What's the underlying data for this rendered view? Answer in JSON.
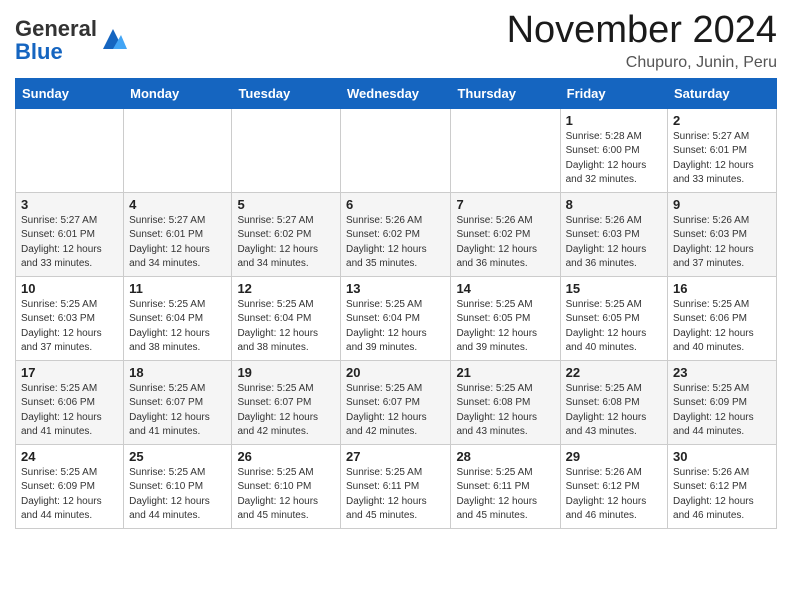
{
  "header": {
    "logo": {
      "general": "General",
      "blue": "Blue"
    },
    "month": "November 2024",
    "location": "Chupuro, Junin, Peru"
  },
  "weekdays": [
    "Sunday",
    "Monday",
    "Tuesday",
    "Wednesday",
    "Thursday",
    "Friday",
    "Saturday"
  ],
  "weeks": [
    [
      {
        "day": "",
        "sunrise": "",
        "sunset": "",
        "daylight": ""
      },
      {
        "day": "",
        "sunrise": "",
        "sunset": "",
        "daylight": ""
      },
      {
        "day": "",
        "sunrise": "",
        "sunset": "",
        "daylight": ""
      },
      {
        "day": "",
        "sunrise": "",
        "sunset": "",
        "daylight": ""
      },
      {
        "day": "",
        "sunrise": "",
        "sunset": "",
        "daylight": ""
      },
      {
        "day": "1",
        "sunrise": "Sunrise: 5:28 AM",
        "sunset": "Sunset: 6:00 PM",
        "daylight": "Daylight: 12 hours and 32 minutes."
      },
      {
        "day": "2",
        "sunrise": "Sunrise: 5:27 AM",
        "sunset": "Sunset: 6:01 PM",
        "daylight": "Daylight: 12 hours and 33 minutes."
      }
    ],
    [
      {
        "day": "3",
        "sunrise": "Sunrise: 5:27 AM",
        "sunset": "Sunset: 6:01 PM",
        "daylight": "Daylight: 12 hours and 33 minutes."
      },
      {
        "day": "4",
        "sunrise": "Sunrise: 5:27 AM",
        "sunset": "Sunset: 6:01 PM",
        "daylight": "Daylight: 12 hours and 34 minutes."
      },
      {
        "day": "5",
        "sunrise": "Sunrise: 5:27 AM",
        "sunset": "Sunset: 6:02 PM",
        "daylight": "Daylight: 12 hours and 34 minutes."
      },
      {
        "day": "6",
        "sunrise": "Sunrise: 5:26 AM",
        "sunset": "Sunset: 6:02 PM",
        "daylight": "Daylight: 12 hours and 35 minutes."
      },
      {
        "day": "7",
        "sunrise": "Sunrise: 5:26 AM",
        "sunset": "Sunset: 6:02 PM",
        "daylight": "Daylight: 12 hours and 36 minutes."
      },
      {
        "day": "8",
        "sunrise": "Sunrise: 5:26 AM",
        "sunset": "Sunset: 6:03 PM",
        "daylight": "Daylight: 12 hours and 36 minutes."
      },
      {
        "day": "9",
        "sunrise": "Sunrise: 5:26 AM",
        "sunset": "Sunset: 6:03 PM",
        "daylight": "Daylight: 12 hours and 37 minutes."
      }
    ],
    [
      {
        "day": "10",
        "sunrise": "Sunrise: 5:25 AM",
        "sunset": "Sunset: 6:03 PM",
        "daylight": "Daylight: 12 hours and 37 minutes."
      },
      {
        "day": "11",
        "sunrise": "Sunrise: 5:25 AM",
        "sunset": "Sunset: 6:04 PM",
        "daylight": "Daylight: 12 hours and 38 minutes."
      },
      {
        "day": "12",
        "sunrise": "Sunrise: 5:25 AM",
        "sunset": "Sunset: 6:04 PM",
        "daylight": "Daylight: 12 hours and 38 minutes."
      },
      {
        "day": "13",
        "sunrise": "Sunrise: 5:25 AM",
        "sunset": "Sunset: 6:04 PM",
        "daylight": "Daylight: 12 hours and 39 minutes."
      },
      {
        "day": "14",
        "sunrise": "Sunrise: 5:25 AM",
        "sunset": "Sunset: 6:05 PM",
        "daylight": "Daylight: 12 hours and 39 minutes."
      },
      {
        "day": "15",
        "sunrise": "Sunrise: 5:25 AM",
        "sunset": "Sunset: 6:05 PM",
        "daylight": "Daylight: 12 hours and 40 minutes."
      },
      {
        "day": "16",
        "sunrise": "Sunrise: 5:25 AM",
        "sunset": "Sunset: 6:06 PM",
        "daylight": "Daylight: 12 hours and 40 minutes."
      }
    ],
    [
      {
        "day": "17",
        "sunrise": "Sunrise: 5:25 AM",
        "sunset": "Sunset: 6:06 PM",
        "daylight": "Daylight: 12 hours and 41 minutes."
      },
      {
        "day": "18",
        "sunrise": "Sunrise: 5:25 AM",
        "sunset": "Sunset: 6:07 PM",
        "daylight": "Daylight: 12 hours and 41 minutes."
      },
      {
        "day": "19",
        "sunrise": "Sunrise: 5:25 AM",
        "sunset": "Sunset: 6:07 PM",
        "daylight": "Daylight: 12 hours and 42 minutes."
      },
      {
        "day": "20",
        "sunrise": "Sunrise: 5:25 AM",
        "sunset": "Sunset: 6:07 PM",
        "daylight": "Daylight: 12 hours and 42 minutes."
      },
      {
        "day": "21",
        "sunrise": "Sunrise: 5:25 AM",
        "sunset": "Sunset: 6:08 PM",
        "daylight": "Daylight: 12 hours and 43 minutes."
      },
      {
        "day": "22",
        "sunrise": "Sunrise: 5:25 AM",
        "sunset": "Sunset: 6:08 PM",
        "daylight": "Daylight: 12 hours and 43 minutes."
      },
      {
        "day": "23",
        "sunrise": "Sunrise: 5:25 AM",
        "sunset": "Sunset: 6:09 PM",
        "daylight": "Daylight: 12 hours and 44 minutes."
      }
    ],
    [
      {
        "day": "24",
        "sunrise": "Sunrise: 5:25 AM",
        "sunset": "Sunset: 6:09 PM",
        "daylight": "Daylight: 12 hours and 44 minutes."
      },
      {
        "day": "25",
        "sunrise": "Sunrise: 5:25 AM",
        "sunset": "Sunset: 6:10 PM",
        "daylight": "Daylight: 12 hours and 44 minutes."
      },
      {
        "day": "26",
        "sunrise": "Sunrise: 5:25 AM",
        "sunset": "Sunset: 6:10 PM",
        "daylight": "Daylight: 12 hours and 45 minutes."
      },
      {
        "day": "27",
        "sunrise": "Sunrise: 5:25 AM",
        "sunset": "Sunset: 6:11 PM",
        "daylight": "Daylight: 12 hours and 45 minutes."
      },
      {
        "day": "28",
        "sunrise": "Sunrise: 5:25 AM",
        "sunset": "Sunset: 6:11 PM",
        "daylight": "Daylight: 12 hours and 45 minutes."
      },
      {
        "day": "29",
        "sunrise": "Sunrise: 5:26 AM",
        "sunset": "Sunset: 6:12 PM",
        "daylight": "Daylight: 12 hours and 46 minutes."
      },
      {
        "day": "30",
        "sunrise": "Sunrise: 5:26 AM",
        "sunset": "Sunset: 6:12 PM",
        "daylight": "Daylight: 12 hours and 46 minutes."
      }
    ]
  ]
}
